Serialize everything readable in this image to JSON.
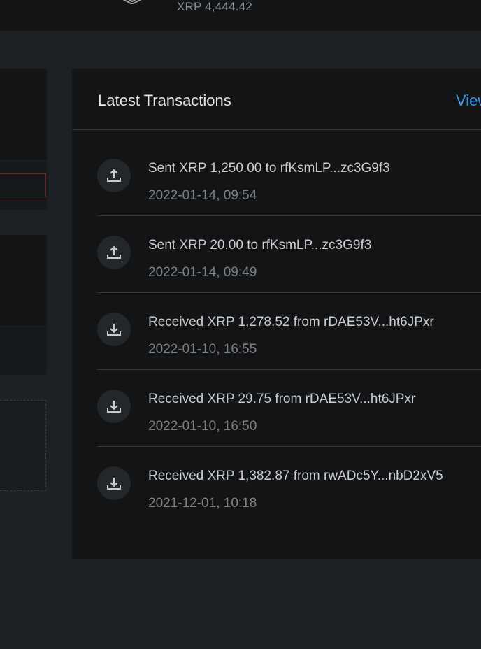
{
  "header": {
    "balance": "XRP 4,444.42"
  },
  "transactions_panel": {
    "title": "Latest Transactions",
    "view_link": "View",
    "items": [
      {
        "direction": "sent",
        "icon": "upload-icon",
        "text": "Sent XRP 1,250.00 to rfKsmLP...zc3G9f3",
        "time": "2022-01-14, 09:54"
      },
      {
        "direction": "sent",
        "icon": "upload-icon",
        "text": "Sent XRP 20.00 to rfKsmLP...zc3G9f3",
        "time": "2022-01-14, 09:49"
      },
      {
        "direction": "received",
        "icon": "download-icon",
        "text": "Received XRP 1,278.52 from rDAE53V...ht6JPxr",
        "time": "2022-01-10, 16:55"
      },
      {
        "direction": "received",
        "icon": "download-icon",
        "text": "Received XRP 29.75 from rDAE53V...ht6JPxr",
        "time": "2022-01-10, 16:50"
      },
      {
        "direction": "received",
        "icon": "download-icon",
        "text": "Received XRP 1,382.87 from rwADc5Y...nbD2xV5",
        "time": "2021-12-01, 10:18"
      }
    ]
  },
  "colors": {
    "background": "#1d2024",
    "panel": "#121416",
    "accent_link": "#2f9be8",
    "error_border": "#7a1f24"
  }
}
